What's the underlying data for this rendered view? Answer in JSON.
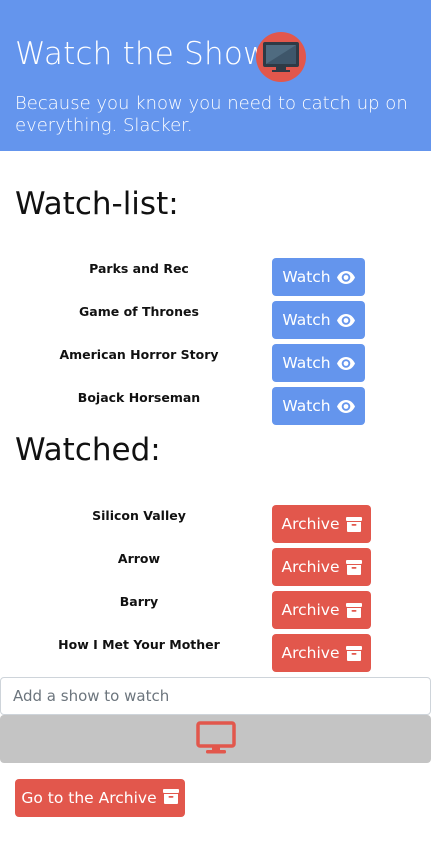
{
  "header": {
    "title": "Watch the Show",
    "subtitle": "Because you know you need to catch up on everything. Slacker.",
    "badge_icon": "tv-icon",
    "background": "#6495ed",
    "badge_color": "#e2574c"
  },
  "watchlist": {
    "title": "Watch-list:",
    "button_label": "Watch",
    "button_icon": "eye-icon",
    "items": [
      {
        "name": "Parks and Rec"
      },
      {
        "name": "Game of Thrones"
      },
      {
        "name": "American Horror Story"
      },
      {
        "name": "Bojack Horseman"
      }
    ]
  },
  "watched": {
    "title": "Watched:",
    "button_label": "Archive",
    "button_icon": "archive-box-icon",
    "items": [
      {
        "name": "Silicon Valley"
      },
      {
        "name": "Arrow"
      },
      {
        "name": "Barry"
      },
      {
        "name": "How I Met Your Mother"
      }
    ]
  },
  "add_show": {
    "placeholder": "Add a show to watch",
    "value": "",
    "button_icon": "monitor-icon"
  },
  "archive_link": {
    "label": "Go to the Archive",
    "icon": "archive-box-icon"
  },
  "colors": {
    "primary": "#6495ed",
    "danger": "#e2574c",
    "muted_button": "#c4c4c4"
  }
}
